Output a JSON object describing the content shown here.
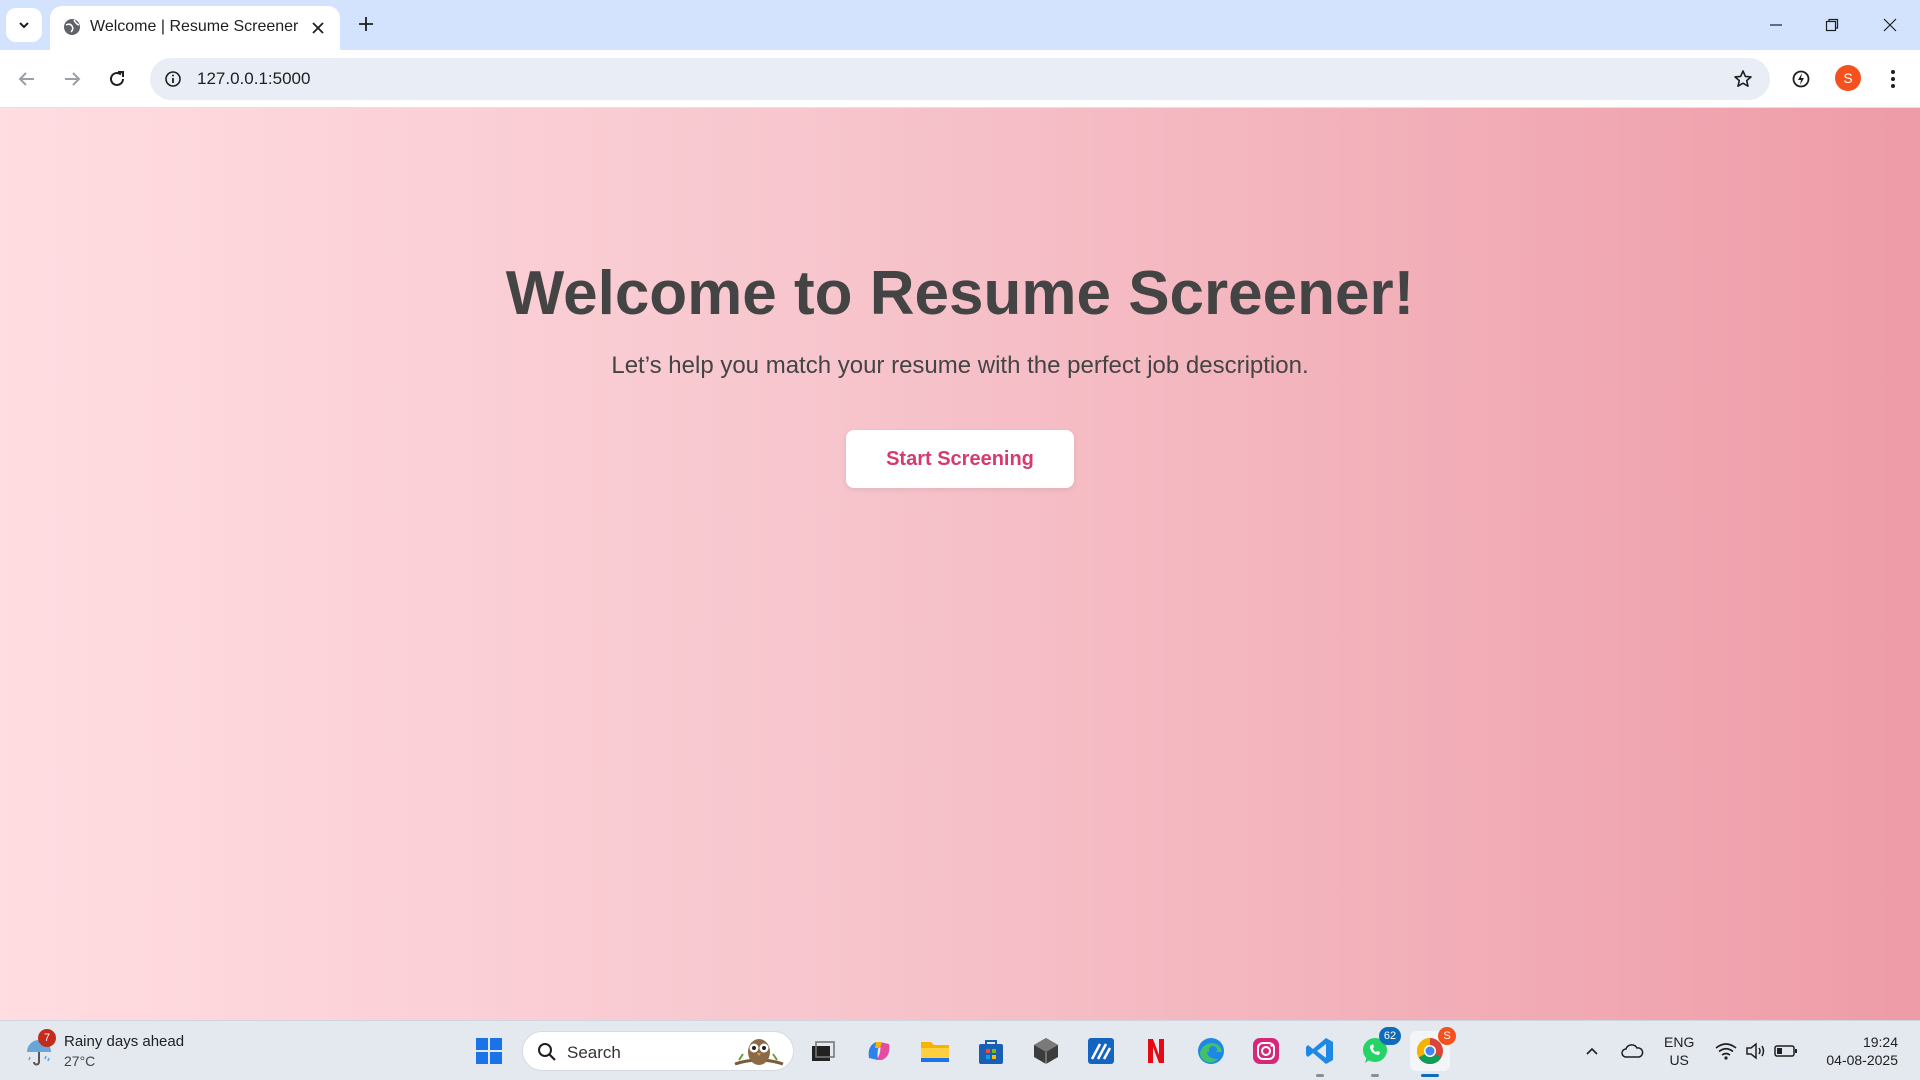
{
  "browser": {
    "tab_title": "Welcome | Resume Screener",
    "url": "127.0.0.1:5000",
    "profile_initial": "S"
  },
  "page": {
    "title": "Welcome to Resume Screener!",
    "subtitle": "Let’s help you match your resume with the perfect job description.",
    "cta_label": "Start Screening"
  },
  "taskbar": {
    "weather_title": "Rainy days ahead",
    "weather_temp": "27°C",
    "weather_badge": "7",
    "search_label": "Search",
    "whatsapp_badge": "62",
    "chrome_badge": "S",
    "lang_line1": "ENG",
    "lang_line2": "US",
    "time": "19:24",
    "date": "04-08-2025"
  },
  "colors": {
    "gradient_start": "#ffdde1",
    "gradient_end": "#ee9ca7",
    "cta_text": "#d63a6e",
    "heading": "#444444"
  }
}
